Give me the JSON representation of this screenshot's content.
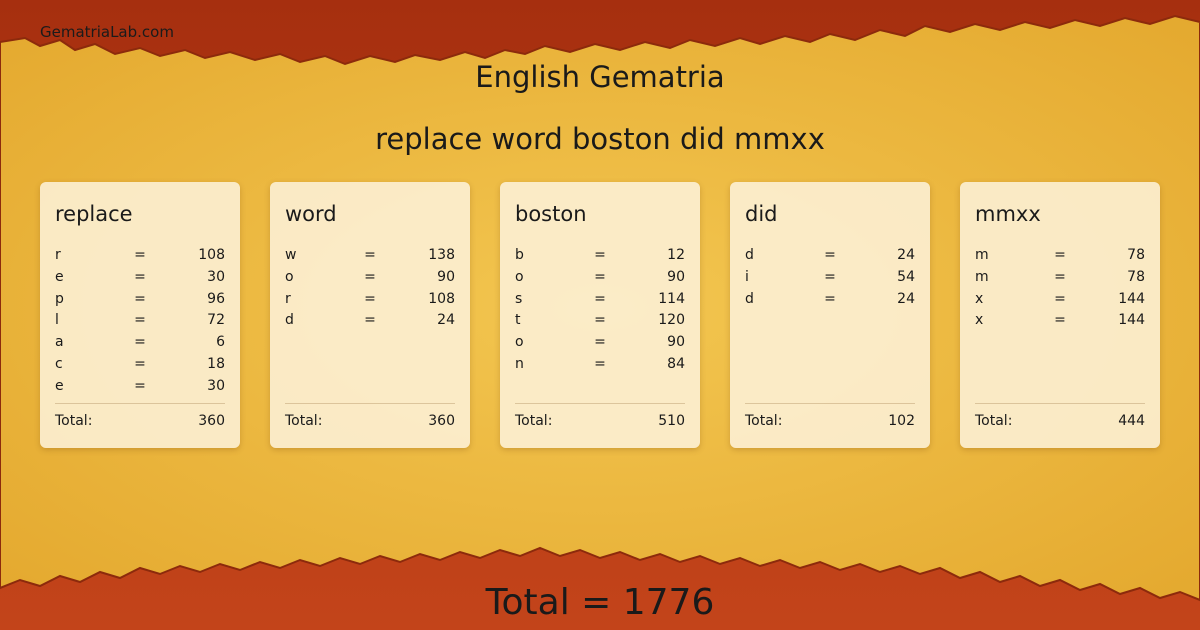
{
  "site": {
    "name": "GematriaLab.com"
  },
  "heading": "English Gematria",
  "phrase": "replace word boston did mmxx",
  "total_label": "Total:",
  "words": [
    {
      "word": "replace",
      "letters": [
        {
          "letter": "r",
          "value": "108"
        },
        {
          "letter": "e",
          "value": "30"
        },
        {
          "letter": "p",
          "value": "96"
        },
        {
          "letter": "l",
          "value": "72"
        },
        {
          "letter": "a",
          "value": "6"
        },
        {
          "letter": "c",
          "value": "18"
        },
        {
          "letter": "e",
          "value": "30"
        }
      ],
      "total": "360"
    },
    {
      "word": "word",
      "letters": [
        {
          "letter": "w",
          "value": "138"
        },
        {
          "letter": "o",
          "value": "90"
        },
        {
          "letter": "r",
          "value": "108"
        },
        {
          "letter": "d",
          "value": "24"
        }
      ],
      "total": "360"
    },
    {
      "word": "boston",
      "letters": [
        {
          "letter": "b",
          "value": "12"
        },
        {
          "letter": "o",
          "value": "90"
        },
        {
          "letter": "s",
          "value": "114"
        },
        {
          "letter": "t",
          "value": "120"
        },
        {
          "letter": "o",
          "value": "90"
        },
        {
          "letter": "n",
          "value": "84"
        }
      ],
      "total": "510"
    },
    {
      "word": "did",
      "letters": [
        {
          "letter": "d",
          "value": "24"
        },
        {
          "letter": "i",
          "value": "54"
        },
        {
          "letter": "d",
          "value": "24"
        }
      ],
      "total": "102"
    },
    {
      "word": "mmxx",
      "letters": [
        {
          "letter": "m",
          "value": "78"
        },
        {
          "letter": "m",
          "value": "78"
        },
        {
          "letter": "x",
          "value": "144"
        },
        {
          "letter": "x",
          "value": "144"
        }
      ],
      "total": "444"
    }
  ],
  "grand_total": "Total = 1776",
  "colors": {
    "paper": "#eab53a",
    "paper_light": "#f3c650",
    "border": "#b83812",
    "border_dark": "#952a0e"
  }
}
